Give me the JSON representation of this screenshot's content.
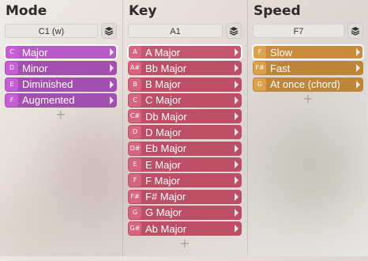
{
  "columns": {
    "mode": {
      "title": "Mode",
      "key_value": "C1 (w)",
      "items": [
        {
          "key": "C",
          "label": "Major",
          "selected": true
        },
        {
          "key": "D",
          "label": "Minor",
          "selected": false
        },
        {
          "key": "E",
          "label": "Diminished",
          "selected": false
        },
        {
          "key": "F",
          "label": "Augmented",
          "selected": false
        }
      ],
      "add_label": "+"
    },
    "key": {
      "title": "Key",
      "key_value": "A1",
      "items": [
        {
          "key": "A",
          "label": "A Major",
          "selected": true
        },
        {
          "key": "A#",
          "label": "Bb Major",
          "selected": false
        },
        {
          "key": "B",
          "label": "B Major",
          "selected": false
        },
        {
          "key": "C",
          "label": "C Major",
          "selected": false
        },
        {
          "key": "C#",
          "label": "Db Major",
          "selected": false
        },
        {
          "key": "D",
          "label": "D Major",
          "selected": false
        },
        {
          "key": "D#",
          "label": "Eb Major",
          "selected": false
        },
        {
          "key": "E",
          "label": "E Major",
          "selected": false
        },
        {
          "key": "F",
          "label": "F Major",
          "selected": false
        },
        {
          "key": "F#",
          "label": "F# Major",
          "selected": false
        },
        {
          "key": "G",
          "label": "G Major",
          "selected": false
        },
        {
          "key": "G#",
          "label": "Ab Major",
          "selected": false
        }
      ],
      "add_label": "+"
    },
    "speed": {
      "title": "Speed",
      "key_value": "F7",
      "items": [
        {
          "key": "F",
          "label": "Slow",
          "selected": true
        },
        {
          "key": "F#",
          "label": "Fast",
          "selected": false
        },
        {
          "key": "G",
          "label": "At once (chord)",
          "selected": false
        }
      ],
      "add_label": "+"
    }
  },
  "icons": {
    "layers": "layers-icon",
    "arrow": "chevron-right-icon",
    "add": "plus-icon"
  }
}
